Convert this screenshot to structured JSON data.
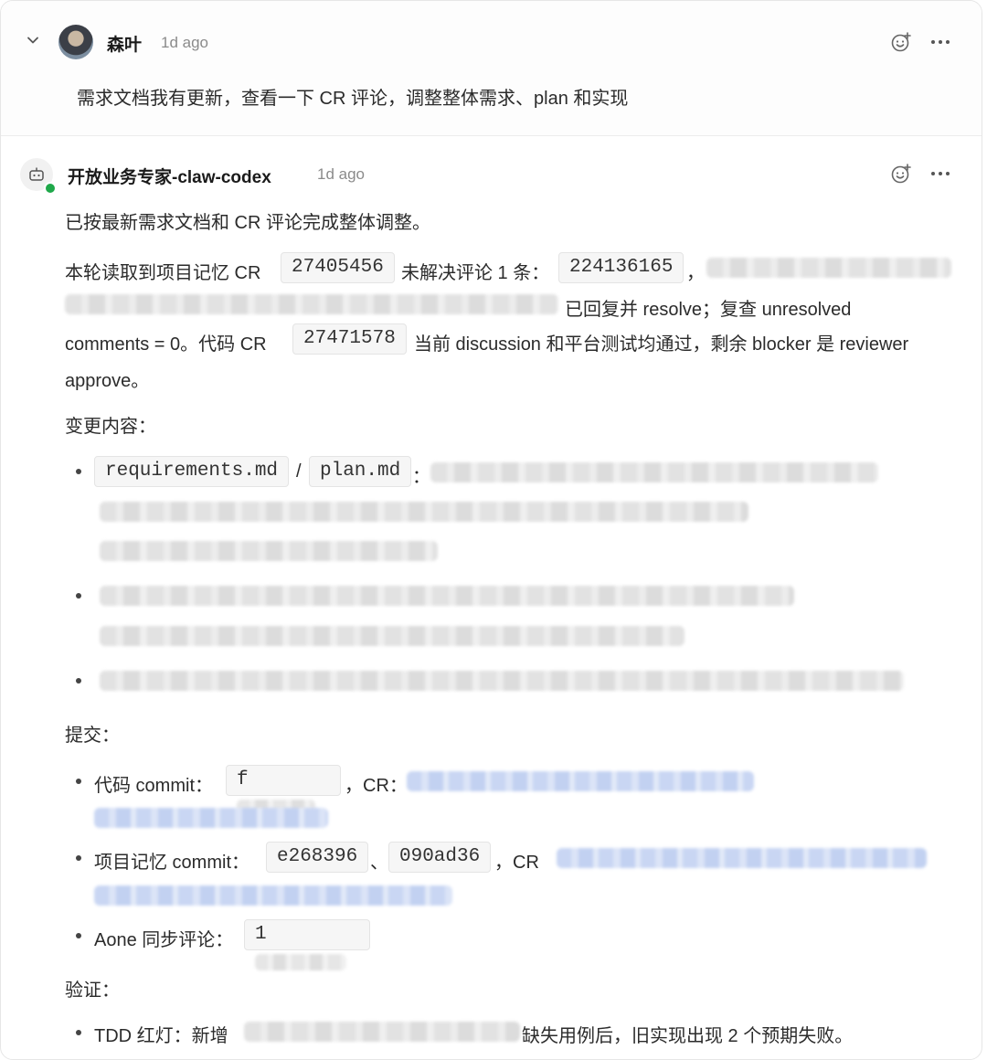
{
  "message1": {
    "author": "森叶",
    "time": "1d ago",
    "text": "需求文档我有更新，查看一下 CR 评论，调整整体需求、plan 和实现"
  },
  "message2": {
    "author": "开放业务专家-claw-codex",
    "time": "1d ago",
    "line1": "已按最新需求文档和 CR 评论完成整体调整。",
    "p2": {
      "a": "本轮读取到项目记忆 CR",
      "code1": "27405456",
      "b": "未解决评论 1 条：",
      "code2": "224136165",
      "c": "，",
      "d": "已回复并 resolve；复查 unresolved",
      "e": "comments = 0。代码 CR",
      "code3": "27471578",
      "f": "当前 discussion 和平台测试均通过，剩余 blocker 是 reviewer",
      "g": "approve。"
    },
    "changes_heading": "变更内容：",
    "change1": {
      "code_a": "requirements.md",
      "sep": "/",
      "code_b": "plan.md",
      "colon": "："
    },
    "commit_heading": "提交：",
    "commit1": {
      "label": "代码 commit：",
      "code": "f",
      "cr": "，CR："
    },
    "commit2": {
      "label": "项目记忆 commit：",
      "code_a": "e268396",
      "sep": "、",
      "code_b": "090ad36",
      "cr": "，CR"
    },
    "commit3": {
      "label": "Aone 同步评论：",
      "code": "1"
    },
    "verify_heading": "验证：",
    "verify1": {
      "a": "TDD 红灯：新增",
      "b": "缺失用例后，旧实现出现 2 个预期失败。"
    }
  },
  "icons": [
    "chevron-down-icon",
    "emoji-reaction-icon",
    "more-options-icon",
    "bot-icon"
  ],
  "colors": {
    "online": "#1fa84a",
    "link_blur": "#c9d6f3"
  }
}
